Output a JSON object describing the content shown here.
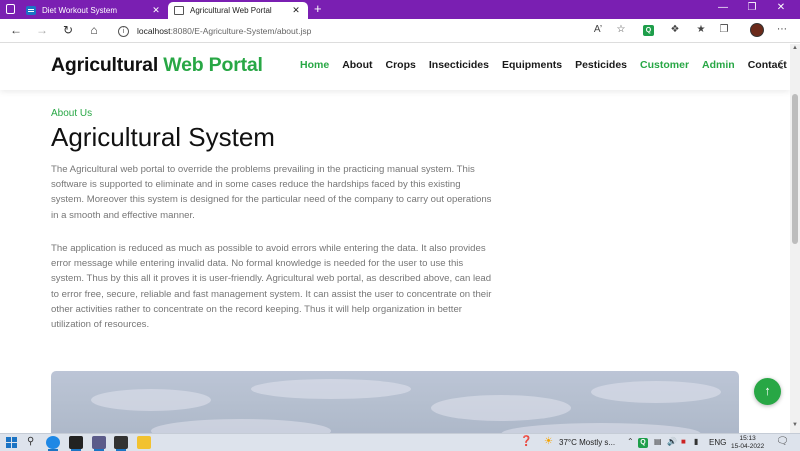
{
  "browser": {
    "tabs": [
      {
        "title": "Diet Workout System",
        "close": "✕",
        "active": false
      },
      {
        "title": "Agricultural Web Portal",
        "close": "✕",
        "active": true
      }
    ],
    "new_tab": "+",
    "window_controls": {
      "minimize": "—",
      "restore": "❐",
      "close": "✕"
    },
    "url_host": "localhost",
    "url_rest": ":8080/E-Agriculture-System/about.jsp",
    "extension_label": "Q"
  },
  "site": {
    "brand_prefix": "Agricultural ",
    "brand_accent": "Web Portal",
    "accent_color": "#28a745",
    "nav": [
      {
        "label": "Home",
        "green": true
      },
      {
        "label": "About",
        "green": false
      },
      {
        "label": "Crops",
        "green": false
      },
      {
        "label": "Insecticides",
        "green": false
      },
      {
        "label": "Equipments",
        "green": false
      },
      {
        "label": "Pesticides",
        "green": false
      },
      {
        "label": "Customer",
        "green": true
      },
      {
        "label": "Admin",
        "green": true
      },
      {
        "label": "Contact",
        "green": false
      }
    ]
  },
  "content": {
    "subtitle": "About Us",
    "heading": "Agricultural System",
    "paragraph1": "The Agricultural web portal to override the problems prevailing in the practicing manual system. This software is supported to eliminate and in some cases reduce the hardships faced by this existing system. Moreover this system is designed for the particular need of the company to carry out operations in a smooth and effective manner.",
    "paragraph2": "The application is reduced as much as possible to avoid errors while entering the data. It also provides error message while entering invalid data. No formal knowledge is needed for the user to use this system. Thus by this all it proves it is user-friendly. Agricultural web portal, as described above, can lead to error free, secure, reliable and fast management system. It can assist the user to concentrate on their other activities rather to concentrate on the record keeping. Thus it will help organization in better utilization of resources."
  },
  "taskbar": {
    "weather": "37°C  Mostly s...",
    "language": "ENG",
    "time": "15:13",
    "date": "15-04-2022"
  }
}
